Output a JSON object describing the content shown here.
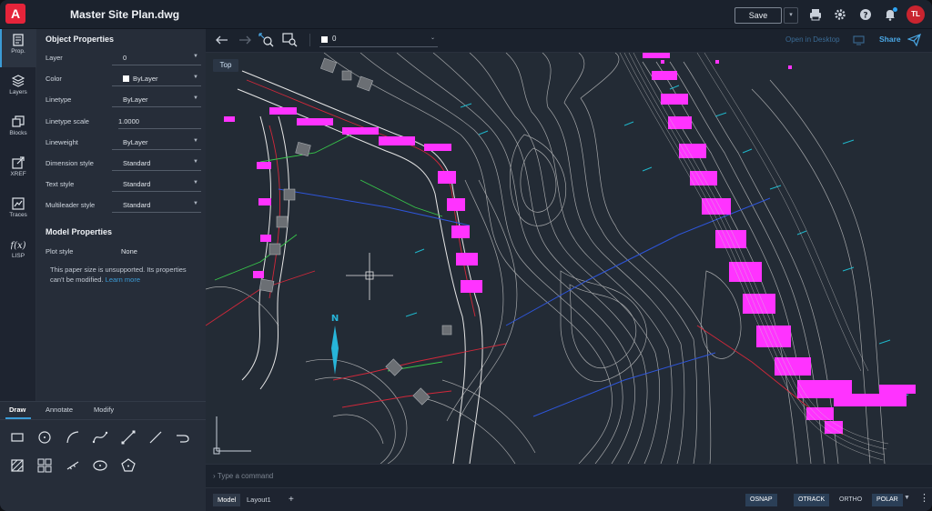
{
  "app": {
    "logo_letter": "A",
    "document_title": "Master Site Plan.dwg",
    "save_label": "Save",
    "user_initials": "TL"
  },
  "rail": [
    {
      "label": "Prop.",
      "icon": "properties-icon"
    },
    {
      "label": "Layers",
      "icon": "layers-icon"
    },
    {
      "label": "Blocks",
      "icon": "blocks-icon"
    },
    {
      "label": "XREF",
      "icon": "xref-icon"
    },
    {
      "label": "Traces",
      "icon": "traces-icon"
    },
    {
      "label": "LISP",
      "icon": "lisp-icon",
      "glyph": "f(x)"
    }
  ],
  "object_properties": {
    "title": "Object Properties",
    "rows": [
      {
        "label": "Layer",
        "value": "0"
      },
      {
        "label": "Color",
        "value": "ByLayer"
      },
      {
        "label": "Linetype",
        "value": "ByLayer"
      },
      {
        "label": "Linetype scale",
        "value": "1.0000"
      },
      {
        "label": "Lineweight",
        "value": "ByLayer"
      },
      {
        "label": "Dimension style",
        "value": "Standard"
      },
      {
        "label": "Text style",
        "value": "Standard"
      },
      {
        "label": "Multileader style",
        "value": "Standard"
      }
    ]
  },
  "model_properties": {
    "title": "Model Properties",
    "plot_style_label": "Plot style",
    "plot_style_value": "None",
    "note_text": "This paper size is unsupported. Its properties can't be modified.",
    "learn_more": "Learn more"
  },
  "draw_panel": {
    "tabs": [
      "Draw",
      "Annotate",
      "Modify"
    ],
    "active_tab": "Draw"
  },
  "canvas_toolbar": {
    "layer_value": "0",
    "open_in_desktop": "Open in Desktop",
    "share": "Share"
  },
  "canvas": {
    "view_label": "Top",
    "north_label": "N"
  },
  "command": {
    "placeholder": "Type a command"
  },
  "status": {
    "tabs": [
      "Model",
      "Layout1"
    ],
    "add_tab": "+",
    "toggles": [
      "OSNAP",
      "OTRACK",
      "ORTHO",
      "POLAR"
    ],
    "active_toggles": [
      "OSNAP",
      "OTRACK",
      "POLAR"
    ]
  },
  "colors": {
    "accent": "#3b9bd6",
    "brand": "#e5243a",
    "magenta": "#ff33ff",
    "contour": "#c8c8c8"
  }
}
